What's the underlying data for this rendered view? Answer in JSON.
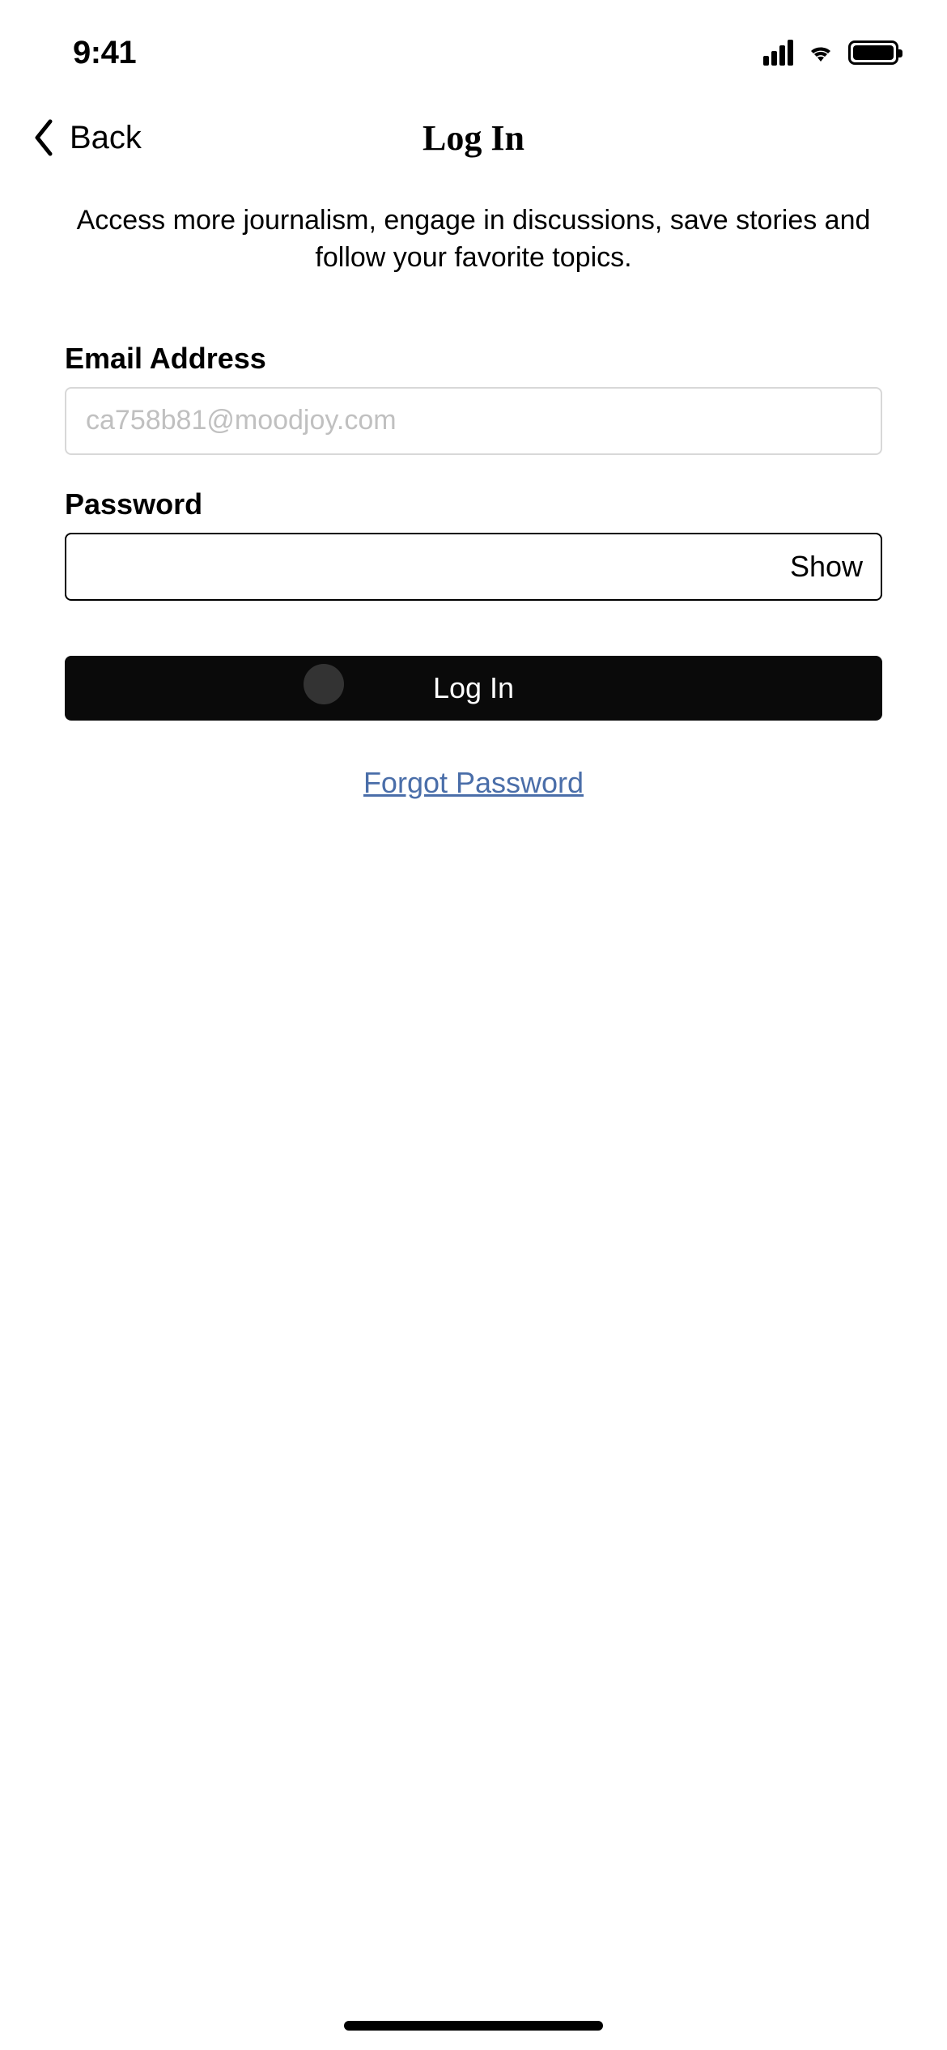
{
  "statusBar": {
    "time": "9:41"
  },
  "nav": {
    "backLabel": "Back",
    "title": "Log In"
  },
  "description": "Access more journalism, engage in discussions, save stories and follow your favorite topics.",
  "form": {
    "emailLabel": "Email Address",
    "emailPlaceholder": "ca758b81@moodjoy.com",
    "emailValue": "",
    "passwordLabel": "Password",
    "passwordValue": "",
    "showPasswordLabel": "Show",
    "loginButtonLabel": "Log In",
    "forgotPasswordLabel": "Forgot Password"
  }
}
